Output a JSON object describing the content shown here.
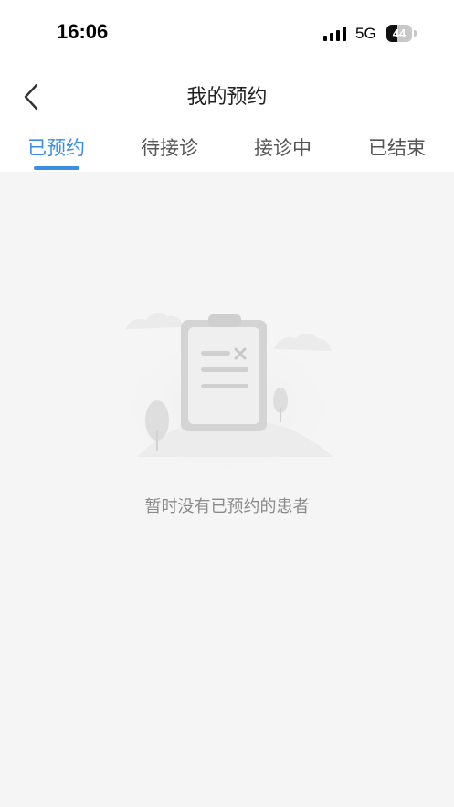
{
  "status_bar": {
    "time": "16:06",
    "network": "5G",
    "battery_level": "44",
    "battery_fraction": 0.44
  },
  "nav": {
    "title": "我的预约",
    "back_icon": "chevron-left-icon"
  },
  "tabs": [
    {
      "label": "已预约",
      "active": true
    },
    {
      "label": "待接诊",
      "active": false
    },
    {
      "label": "接诊中",
      "active": false
    },
    {
      "label": "已结束",
      "active": false
    }
  ],
  "empty_state": {
    "message": "暂时没有已预约的患者",
    "icon": "empty-clipboard-icon"
  },
  "colors": {
    "accent": "#3a8ee6",
    "background": "#f5f5f5",
    "muted_text": "#8a8a8a"
  }
}
